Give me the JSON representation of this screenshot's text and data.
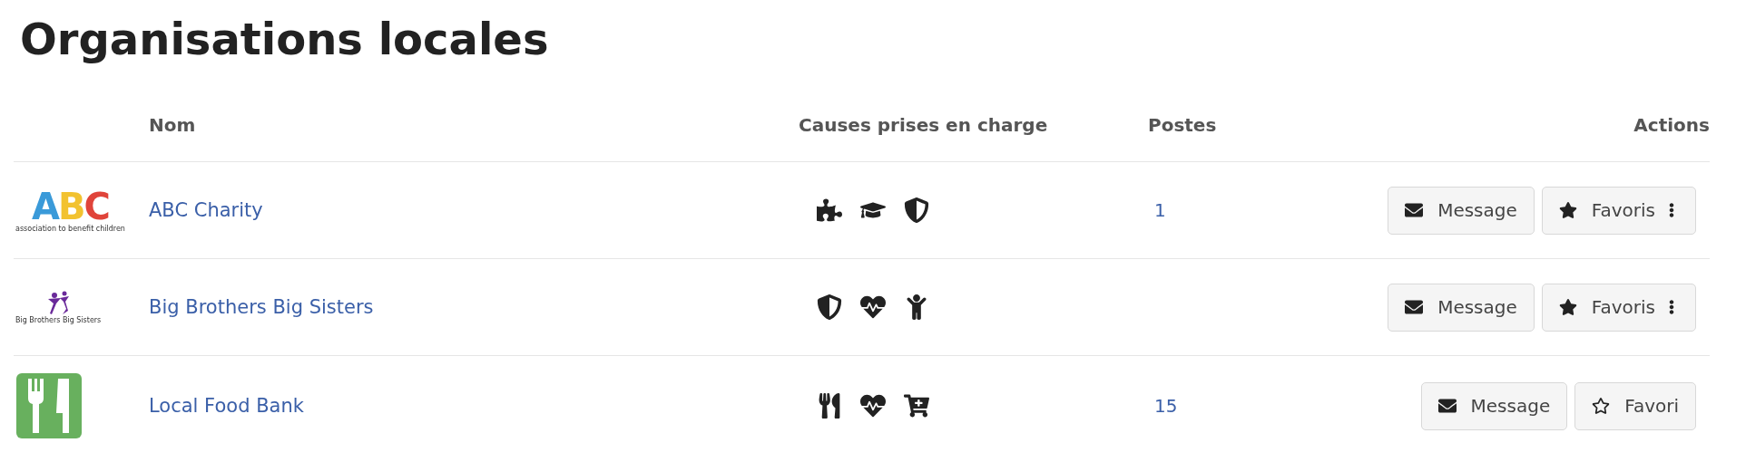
{
  "title": "Organisations locales",
  "columns": [
    "Nom",
    "Causes prises en charge",
    "Postes",
    "Actions"
  ],
  "rows": [
    {
      "logo": {
        "kind": "letters",
        "text": "ABC",
        "caption": "association to benefit children"
      },
      "name": "ABC Charity",
      "causes": [
        {
          "kind": "puzzle"
        },
        {
          "kind": "education"
        },
        {
          "kind": "shield"
        }
      ],
      "postes": "1",
      "message": "Message",
      "favorite": {
        "label": "Favoris",
        "selected": true
      }
    },
    {
      "logo": {
        "kind": "figures",
        "caption": "Big Brothers Big Sisters"
      },
      "name": "Big Brothers Big Sisters",
      "causes": [
        {
          "kind": "shield"
        },
        {
          "kind": "health"
        },
        {
          "kind": "child"
        }
      ],
      "message": "Message",
      "favorite": {
        "label": "Favoris",
        "selected": true
      }
    },
    {
      "logo": {
        "kind": "food"
      },
      "name": "Local Food Bank",
      "causes": [
        {
          "kind": "food"
        },
        {
          "kind": "health"
        },
        {
          "kind": "cart"
        }
      ],
      "postes": "15",
      "message": "Message",
      "favorite": {
        "label": "Favori",
        "selected": false
      }
    }
  ]
}
